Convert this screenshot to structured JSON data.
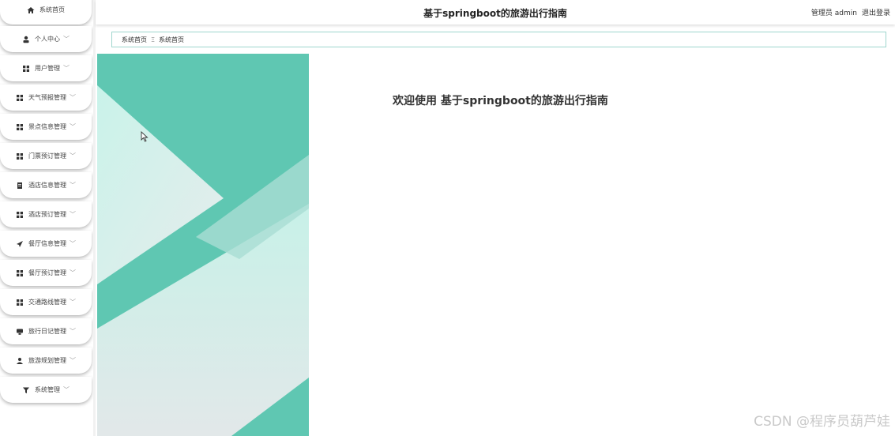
{
  "header": {
    "site_title": "基于springboot的旅游出行指南",
    "user_label": "管理员 admin",
    "logout_label": "退出登录"
  },
  "sidebar": {
    "items": [
      {
        "label": "系统首页",
        "icon": "home-icon",
        "has_chevron": false
      },
      {
        "label": "个人中心",
        "icon": "person-icon",
        "has_chevron": true
      },
      {
        "label": "用户管理",
        "icon": "grid-icon",
        "has_chevron": true
      },
      {
        "label": "天气预报管理",
        "icon": "grid-icon",
        "has_chevron": true
      },
      {
        "label": "景点信息管理",
        "icon": "grid-icon",
        "has_chevron": true
      },
      {
        "label": "门票预订管理",
        "icon": "grid-icon",
        "has_chevron": true
      },
      {
        "label": "酒店信息管理",
        "icon": "document-icon",
        "has_chevron": true
      },
      {
        "label": "酒店预订管理",
        "icon": "grid-icon",
        "has_chevron": true
      },
      {
        "label": "餐厅信息管理",
        "icon": "send-icon",
        "has_chevron": true
      },
      {
        "label": "餐厅预订管理",
        "icon": "grid-icon",
        "has_chevron": true
      },
      {
        "label": "交通路线管理",
        "icon": "grid-icon",
        "has_chevron": true
      },
      {
        "label": "旅行日记管理",
        "icon": "monitor-icon",
        "has_chevron": true
      },
      {
        "label": "旅游规划管理",
        "icon": "person-plan-icon",
        "has_chevron": true
      },
      {
        "label": "系统管理",
        "icon": "funnel-icon",
        "has_chevron": true
      }
    ]
  },
  "breadcrumb": {
    "items": [
      "系统首页",
      "系统首页"
    ],
    "separator": "Ξ"
  },
  "main": {
    "welcome_text": "欢迎使用 基于springboot的旅游出行指南"
  },
  "watermark": "CSDN @程序员葫芦娃",
  "colors": {
    "accent": "#5fc7b2",
    "accent_light": "#c7f1e8",
    "breadcrumb_border": "#9fd6ce"
  }
}
